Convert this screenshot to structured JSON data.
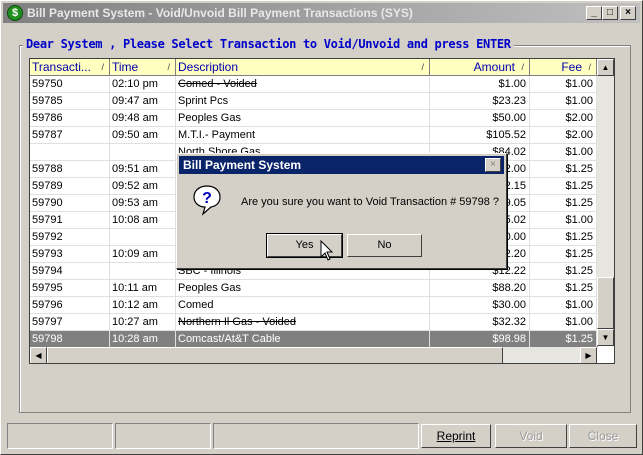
{
  "window": {
    "title": "Bill Payment System - Void/Unvoid Bill Payment Transactions (SYS)",
    "app_icon": "$",
    "minimize_glyph": "_",
    "maximize_glyph": "□",
    "close_glyph": "×"
  },
  "group": {
    "legend": "Dear System , Please Select Transaction to Void/Unvoid and press ENTER"
  },
  "grid": {
    "columns": [
      {
        "label": "Transacti...",
        "sort": "/"
      },
      {
        "label": "Time",
        "sort": "/"
      },
      {
        "label": "Description",
        "sort": "/"
      },
      {
        "label": "Amount",
        "sort": "/"
      },
      {
        "label": "Fee",
        "sort": "/"
      }
    ],
    "rows": [
      {
        "id": "59750",
        "time": "02:10 pm",
        "desc": "Comed - Voided",
        "amount": "$1.00",
        "fee": "$1.00",
        "voided": true
      },
      {
        "id": "59785",
        "time": "09:47 am",
        "desc": "Sprint Pcs",
        "amount": "$23.23",
        "fee": "$1.00"
      },
      {
        "id": "59786",
        "time": "09:48 am",
        "desc": "Peoples Gas",
        "amount": "$50.00",
        "fee": "$2.00"
      },
      {
        "id": "59787",
        "time": "09:50 am",
        "desc": "M.T.I.- Payment",
        "amount": "$105.52",
        "fee": "$2.00"
      },
      {
        "id": "",
        "time": "",
        "desc": "North Shore Gas",
        "amount": "$84.02",
        "fee": "$1.00"
      },
      {
        "id": "59788",
        "time": "09:51 am",
        "desc": "",
        "amount": "$2.00",
        "fee": "$1.25"
      },
      {
        "id": "59789",
        "time": "09:52 am",
        "desc": "",
        "amount": "$2.15",
        "fee": "$1.25"
      },
      {
        "id": "59790",
        "time": "09:53 am",
        "desc": "",
        "amount": "$9.05",
        "fee": "$1.25"
      },
      {
        "id": "59791",
        "time": "10:08 am",
        "desc": "",
        "amount": "$5.02",
        "fee": "$1.00"
      },
      {
        "id": "59792",
        "time": "",
        "desc": "",
        "amount": "$0.00",
        "fee": "$1.25"
      },
      {
        "id": "59793",
        "time": "10:09 am",
        "desc": "",
        "amount": "$2.20",
        "fee": "$1.25"
      },
      {
        "id": "59794",
        "time": "",
        "desc": "SBC - Illinois",
        "amount": "$12.22",
        "fee": "$1.25"
      },
      {
        "id": "59795",
        "time": "10:11 am",
        "desc": "Peoples Gas",
        "amount": "$88.20",
        "fee": "$1.25"
      },
      {
        "id": "59796",
        "time": "10:12 am",
        "desc": "Comed",
        "amount": "$30.00",
        "fee": "$1.00"
      },
      {
        "id": "59797",
        "time": "10:27 am",
        "desc": "Northern Il Gas - Voided",
        "amount": "$32.32",
        "fee": "$1.00",
        "voided": true
      },
      {
        "id": "59798",
        "time": "10:28 am",
        "desc": "Comcast/At&T Cable",
        "amount": "$98.98",
        "fee": "$1.25",
        "selected": true
      }
    ],
    "scroll_up_glyph": "▲",
    "scroll_down_glyph": "▼",
    "scroll_left_glyph": "◀",
    "scroll_right_glyph": "▶"
  },
  "buttons": {
    "reprint": "Reprint",
    "void": "Void",
    "close": "Close"
  },
  "dialog": {
    "title": "Bill Payment System",
    "close_glyph": "×",
    "icon": "question-icon",
    "message": "Are you sure you want to Void Transaction # 59798 ?",
    "yes": "Yes",
    "no": "No"
  }
}
